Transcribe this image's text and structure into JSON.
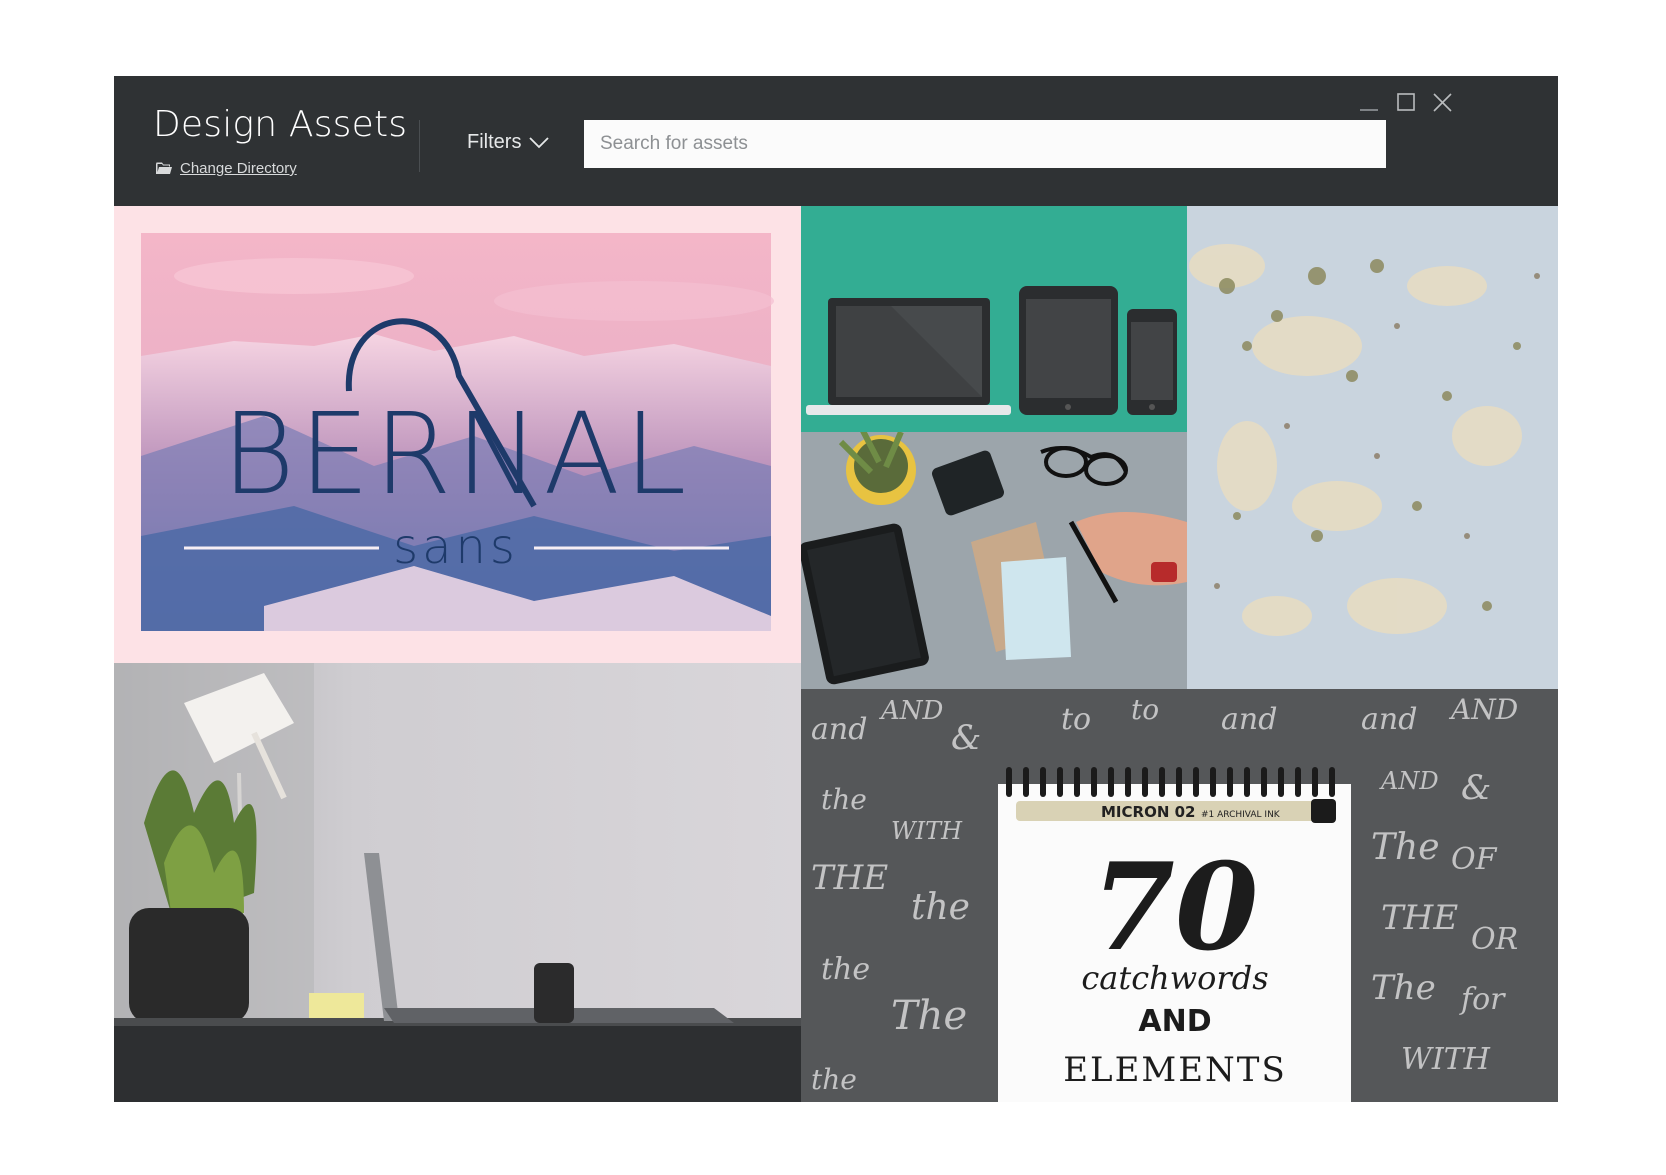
{
  "window": {
    "title": "Design Assets",
    "change_directory": "Change Directory",
    "filters_label": "Filters",
    "search_placeholder": "Search for assets"
  },
  "tiles": {
    "bernal": {
      "title": "BERNAL",
      "subtitle": "sans"
    },
    "micron": {
      "pen_label": "MICRON 02",
      "pen_sub": "#1 ARCHIVAL INK",
      "number": "70",
      "line1": "catchwords",
      "line2": "AND",
      "line3": "ELEMENTS"
    }
  },
  "icons": [
    "folder-icon",
    "chevron-down-icon",
    "minimize-icon",
    "maximize-icon",
    "close-icon"
  ],
  "colors": {
    "titlebar": "#2f3234",
    "devices_bg": "#33ad93",
    "bernal_bg": "#fde2e6",
    "bernal_text": "#1e3a6a"
  }
}
